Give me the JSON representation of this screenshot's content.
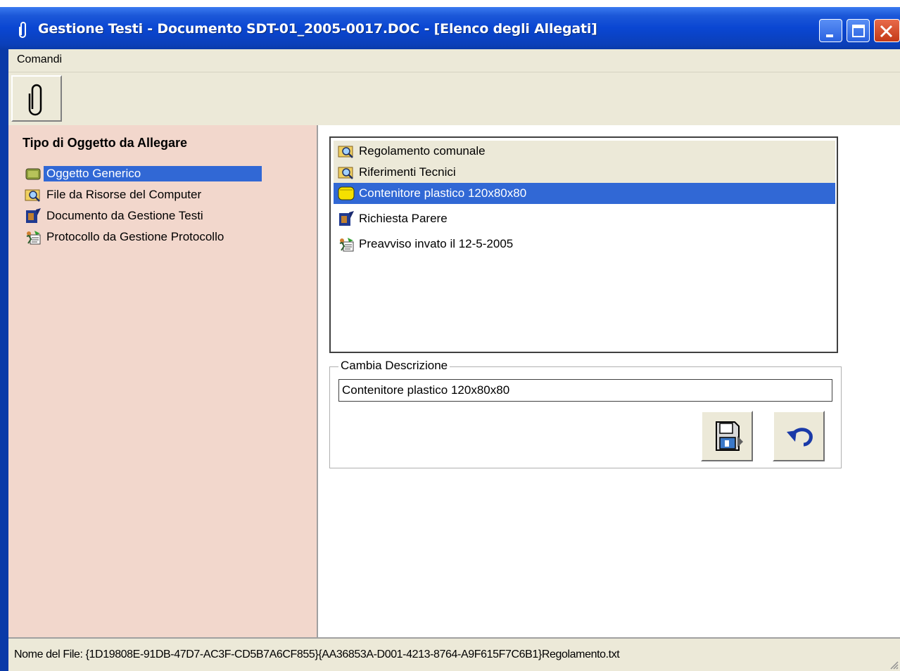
{
  "window": {
    "title": "Gestione Testi - Documento SDT-01_2005-0017.DOC - [Elenco degli Allegati]"
  },
  "menu": {
    "items": [
      {
        "label": "Comandi"
      }
    ]
  },
  "toolbar": {
    "buttons": [
      {
        "icon": "paperclip-icon"
      }
    ]
  },
  "left_panel": {
    "heading": "Tipo di Oggetto da Allegare",
    "items": [
      {
        "label": "Oggetto Generico",
        "icon": "generic-object-icon",
        "selected": true
      },
      {
        "label": "File da Risorse del Computer",
        "icon": "folder-search-icon",
        "selected": false
      },
      {
        "label": "Documento da Gestione Testi",
        "icon": "document-icon",
        "selected": false
      },
      {
        "label": "Protocollo da Gestione Protocollo",
        "icon": "protocol-icon",
        "selected": false
      }
    ]
  },
  "attachments": {
    "items": [
      {
        "label": "Regolamento comunale",
        "icon": "folder-search-icon"
      },
      {
        "label": "Riferimenti Tecnici",
        "icon": "folder-search-icon"
      },
      {
        "label": "Contenitore plastico 120x80x80",
        "icon": "generic-object-icon",
        "selected": true
      },
      {
        "label": "Richiesta Parere",
        "icon": "document-icon"
      },
      {
        "label": "Preavviso invato il 12-5-2005",
        "icon": "protocol-icon"
      }
    ]
  },
  "description": {
    "legend": "Cambia Descrizione",
    "value": "Contenitore plastico 120x80x80"
  },
  "actions": [
    {
      "icon": "save-disk-icon"
    },
    {
      "icon": "undo-arrow-icon"
    }
  ],
  "status": {
    "text": "Nome del File: {1D19808E-91DB-47D7-AC3F-CD5B7A6CF855}{AA36853A-D001-4213-8764-A9F615F7C6B1}Regolamento.txt"
  },
  "colors": {
    "titlebar": "#0a46d2",
    "left_panel_bg": "#f2d7cc",
    "selection": "#3168d5",
    "chrome": "#ece9d8"
  }
}
